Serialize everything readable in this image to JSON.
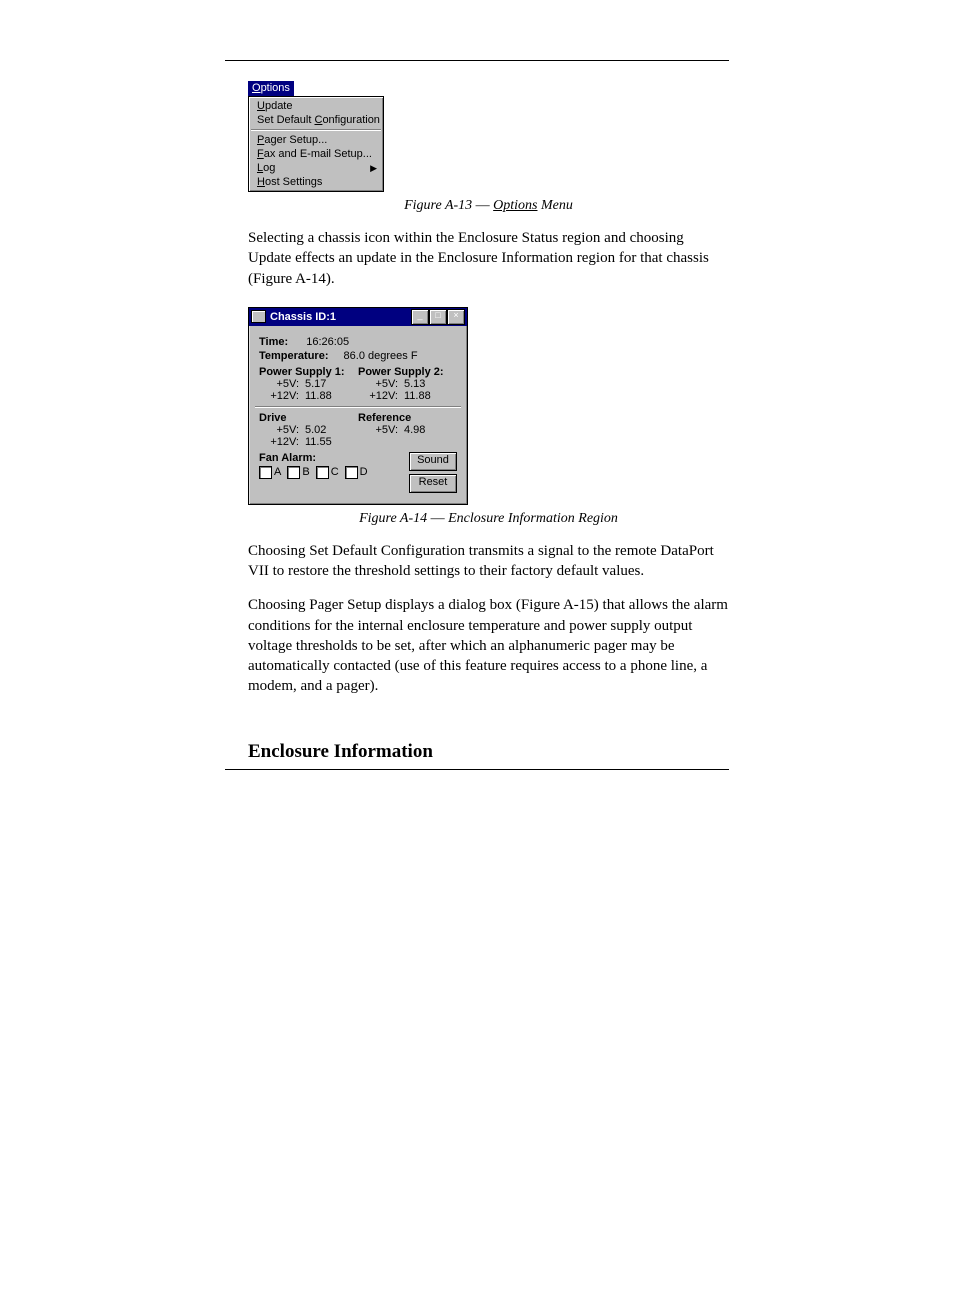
{
  "figureA13": {
    "menu_title": "Options",
    "items_group1": [
      {
        "label": "Update",
        "underline_index": 0
      },
      {
        "label": "Set Default Configuration",
        "underline_index": 12
      }
    ],
    "items_group2": [
      {
        "label": "Pager Setup...",
        "underline_index": 0
      },
      {
        "label": "Fax and E-mail Setup...",
        "underline_index": 0
      },
      {
        "label": "Log",
        "underline_index": 0,
        "submenu": true
      },
      {
        "label": "Host Settings",
        "underline_index": 0
      }
    ],
    "caption_prefix": "Figure A-13",
    "caption_dash": " — ",
    "caption_ref": "Options",
    "caption_suffix": " Menu"
  },
  "paragraph1": "Selecting a chassis icon within the Enclosure Status region and choosing Update effects an update in the Enclosure Information region for that chassis (Figure A-14).",
  "figureA14": {
    "title": "Chassis ID:1",
    "time_label": "Time:",
    "time_value": "16:26:05",
    "temp_label": "Temperature:",
    "temp_value": "86.0 degrees F",
    "ps1_label": "Power Supply 1:",
    "ps2_label": "Power Supply 2:",
    "ps1_5v_k": "+5V:",
    "ps1_5v_v": "5.17",
    "ps1_12v_k": "+12V:",
    "ps1_12v_v": "11.88",
    "ps2_5v_k": "+5V:",
    "ps2_5v_v": "5.13",
    "ps2_12v_k": "+12V:",
    "ps2_12v_v": "11.88",
    "drive_label": "Drive",
    "ref_label": "Reference",
    "drv_5v_k": "+5V:",
    "drv_5v_v": "5.02",
    "drv_12v_k": "+12V:",
    "drv_12v_v": "11.55",
    "ref_5v_k": "+5V:",
    "ref_5v_v": "4.98",
    "fan_label": "Fan Alarm:",
    "fan_checks": [
      "A",
      "B",
      "C",
      "D"
    ],
    "btn_sound": "Sound",
    "btn_reset": "Reset",
    "caption_prefix": "Figure A-14",
    "caption_dash": " — ",
    "caption_suffix": "Enclosure Information Region"
  },
  "paragraph2": "Choosing Set Default Configuration transmits a signal to the remote DataPort VII to restore the threshold settings to their factory default values.",
  "paragraph3": "Choosing Pager Setup displays a dialog box (Figure A-15) that allows the alarm conditions for the internal enclosure temperature and power supply output voltage thresholds to be set, after which an alphanumeric pager may be automatically contacted (use of this feature requires access to a phone line, a modem, and a pager).",
  "section_heading": "Enclosure Information"
}
